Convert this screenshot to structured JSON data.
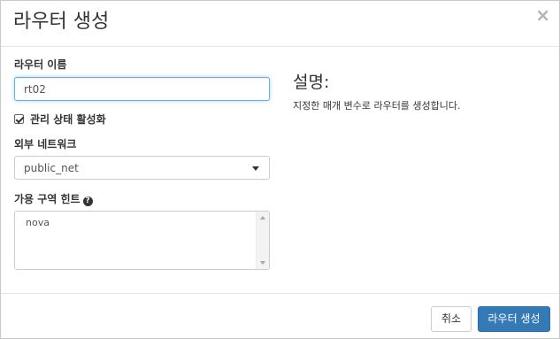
{
  "modal": {
    "title": "라우터 생성",
    "close_glyph": "×"
  },
  "form": {
    "router_name": {
      "label": "라우터 이름",
      "value": "rt02"
    },
    "admin_state": {
      "label": "관리 상태 활성화",
      "checked": true
    },
    "external_network": {
      "label": "외부 네트워크",
      "selected": "public_net"
    },
    "availability_zone_hint": {
      "label": "가용 구역 힌트",
      "help_glyph": "?",
      "options": [
        "nova"
      ]
    }
  },
  "description": {
    "title": "설명:",
    "text": "지정한 매개 변수로 라우터를 생성합니다."
  },
  "footer": {
    "cancel_label": "취소",
    "submit_label": "라우터 생성"
  },
  "colors": {
    "primary": "#337ab7",
    "focus_border": "#66afe9"
  },
  "icons": {
    "close": "close-icon",
    "help": "question-circle-icon",
    "caret": "caret-down-icon",
    "check": "check-icon"
  }
}
